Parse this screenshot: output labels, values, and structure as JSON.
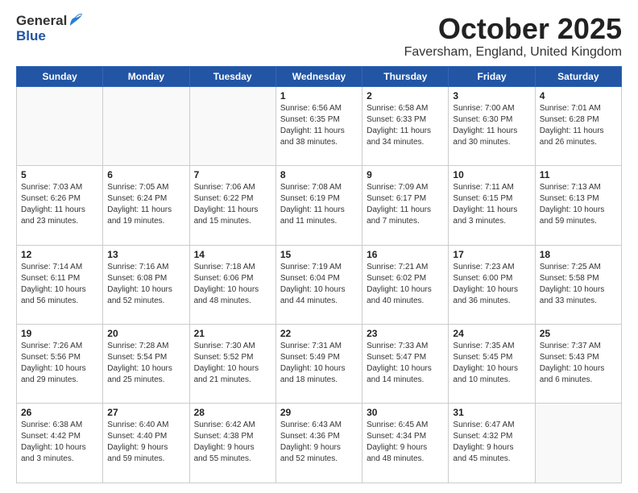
{
  "logo": {
    "general": "General",
    "blue": "Blue"
  },
  "title": {
    "month": "October 2025",
    "location": "Faversham, England, United Kingdom"
  },
  "weekdays": [
    "Sunday",
    "Monday",
    "Tuesday",
    "Wednesday",
    "Thursday",
    "Friday",
    "Saturday"
  ],
  "weeks": [
    [
      {
        "day": "",
        "info": ""
      },
      {
        "day": "",
        "info": ""
      },
      {
        "day": "",
        "info": ""
      },
      {
        "day": "1",
        "info": "Sunrise: 6:56 AM\nSunset: 6:35 PM\nDaylight: 11 hours\nand 38 minutes."
      },
      {
        "day": "2",
        "info": "Sunrise: 6:58 AM\nSunset: 6:33 PM\nDaylight: 11 hours\nand 34 minutes."
      },
      {
        "day": "3",
        "info": "Sunrise: 7:00 AM\nSunset: 6:30 PM\nDaylight: 11 hours\nand 30 minutes."
      },
      {
        "day": "4",
        "info": "Sunrise: 7:01 AM\nSunset: 6:28 PM\nDaylight: 11 hours\nand 26 minutes."
      }
    ],
    [
      {
        "day": "5",
        "info": "Sunrise: 7:03 AM\nSunset: 6:26 PM\nDaylight: 11 hours\nand 23 minutes."
      },
      {
        "day": "6",
        "info": "Sunrise: 7:05 AM\nSunset: 6:24 PM\nDaylight: 11 hours\nand 19 minutes."
      },
      {
        "day": "7",
        "info": "Sunrise: 7:06 AM\nSunset: 6:22 PM\nDaylight: 11 hours\nand 15 minutes."
      },
      {
        "day": "8",
        "info": "Sunrise: 7:08 AM\nSunset: 6:19 PM\nDaylight: 11 hours\nand 11 minutes."
      },
      {
        "day": "9",
        "info": "Sunrise: 7:09 AM\nSunset: 6:17 PM\nDaylight: 11 hours\nand 7 minutes."
      },
      {
        "day": "10",
        "info": "Sunrise: 7:11 AM\nSunset: 6:15 PM\nDaylight: 11 hours\nand 3 minutes."
      },
      {
        "day": "11",
        "info": "Sunrise: 7:13 AM\nSunset: 6:13 PM\nDaylight: 10 hours\nand 59 minutes."
      }
    ],
    [
      {
        "day": "12",
        "info": "Sunrise: 7:14 AM\nSunset: 6:11 PM\nDaylight: 10 hours\nand 56 minutes."
      },
      {
        "day": "13",
        "info": "Sunrise: 7:16 AM\nSunset: 6:08 PM\nDaylight: 10 hours\nand 52 minutes."
      },
      {
        "day": "14",
        "info": "Sunrise: 7:18 AM\nSunset: 6:06 PM\nDaylight: 10 hours\nand 48 minutes."
      },
      {
        "day": "15",
        "info": "Sunrise: 7:19 AM\nSunset: 6:04 PM\nDaylight: 10 hours\nand 44 minutes."
      },
      {
        "day": "16",
        "info": "Sunrise: 7:21 AM\nSunset: 6:02 PM\nDaylight: 10 hours\nand 40 minutes."
      },
      {
        "day": "17",
        "info": "Sunrise: 7:23 AM\nSunset: 6:00 PM\nDaylight: 10 hours\nand 36 minutes."
      },
      {
        "day": "18",
        "info": "Sunrise: 7:25 AM\nSunset: 5:58 PM\nDaylight: 10 hours\nand 33 minutes."
      }
    ],
    [
      {
        "day": "19",
        "info": "Sunrise: 7:26 AM\nSunset: 5:56 PM\nDaylight: 10 hours\nand 29 minutes."
      },
      {
        "day": "20",
        "info": "Sunrise: 7:28 AM\nSunset: 5:54 PM\nDaylight: 10 hours\nand 25 minutes."
      },
      {
        "day": "21",
        "info": "Sunrise: 7:30 AM\nSunset: 5:52 PM\nDaylight: 10 hours\nand 21 minutes."
      },
      {
        "day": "22",
        "info": "Sunrise: 7:31 AM\nSunset: 5:49 PM\nDaylight: 10 hours\nand 18 minutes."
      },
      {
        "day": "23",
        "info": "Sunrise: 7:33 AM\nSunset: 5:47 PM\nDaylight: 10 hours\nand 14 minutes."
      },
      {
        "day": "24",
        "info": "Sunrise: 7:35 AM\nSunset: 5:45 PM\nDaylight: 10 hours\nand 10 minutes."
      },
      {
        "day": "25",
        "info": "Sunrise: 7:37 AM\nSunset: 5:43 PM\nDaylight: 10 hours\nand 6 minutes."
      }
    ],
    [
      {
        "day": "26",
        "info": "Sunrise: 6:38 AM\nSunset: 4:42 PM\nDaylight: 10 hours\nand 3 minutes."
      },
      {
        "day": "27",
        "info": "Sunrise: 6:40 AM\nSunset: 4:40 PM\nDaylight: 9 hours\nand 59 minutes."
      },
      {
        "day": "28",
        "info": "Sunrise: 6:42 AM\nSunset: 4:38 PM\nDaylight: 9 hours\nand 55 minutes."
      },
      {
        "day": "29",
        "info": "Sunrise: 6:43 AM\nSunset: 4:36 PM\nDaylight: 9 hours\nand 52 minutes."
      },
      {
        "day": "30",
        "info": "Sunrise: 6:45 AM\nSunset: 4:34 PM\nDaylight: 9 hours\nand 48 minutes."
      },
      {
        "day": "31",
        "info": "Sunrise: 6:47 AM\nSunset: 4:32 PM\nDaylight: 9 hours\nand 45 minutes."
      },
      {
        "day": "",
        "info": ""
      }
    ]
  ]
}
